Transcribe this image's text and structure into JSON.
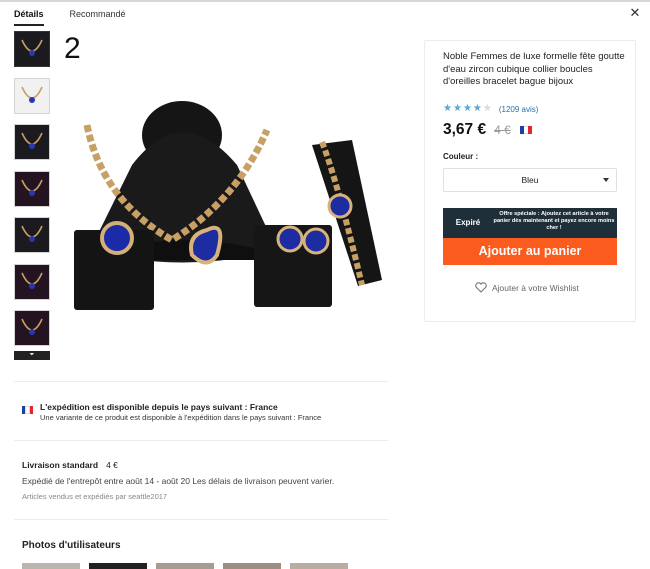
{
  "tabs": {
    "details": "Détails",
    "recommended": "Recommandé"
  },
  "close_icon": "✕",
  "gallery": {
    "counter": "2",
    "thumbnails": [
      {
        "icon": "jewelry-thumb-icon"
      },
      {
        "icon": "jewelry-thumb-icon"
      },
      {
        "icon": "jewelry-thumb-icon"
      },
      {
        "icon": "jewelry-thumb-icon"
      },
      {
        "icon": "jewelry-thumb-icon"
      },
      {
        "icon": "jewelry-thumb-icon"
      },
      {
        "icon": "jewelry-thumb-icon"
      }
    ],
    "more_icon": "⏷"
  },
  "product": {
    "title": "Noble Femmes de luxe formelle fête goutte d'eau zircon cubique collier boucles d'oreilles bracelet bague bijoux",
    "rating": 4,
    "rating_max": 5,
    "reviews": "(1209 avis)",
    "price": "3,67 €",
    "old_price": "4 €",
    "color_label": "Couleur :",
    "color_value": "Bleu",
    "promo_expired": "Expiré",
    "promo_text": "Offre spéciale : Ajoutez cet article à votre panier dès maintenant et payez encore moins cher !",
    "add_to_cart": "Ajouter au panier",
    "wishlist": "Ajouter à votre Wishlist"
  },
  "shipping": {
    "title": "L'expédition est disponible depuis le pays suivant : France",
    "subtitle": "Une variante de ce produit est disponible à l'expédition dans le pays suivant : France"
  },
  "delivery": {
    "title": "Livraison standard",
    "price": "4 €",
    "details": "Expédié de l'entrepôt entre août 14 - août 20 Les délais de livraison peuvent varier.",
    "seller": "Articles vendus et expédiés par seattle2017"
  },
  "photos": {
    "title": "Photos d'utilisateurs"
  },
  "colors": {
    "accent": "#fb5b1c",
    "promo_bg": "#1f2f3a",
    "star": "#5aa6d8",
    "link": "#2a6fa8"
  }
}
